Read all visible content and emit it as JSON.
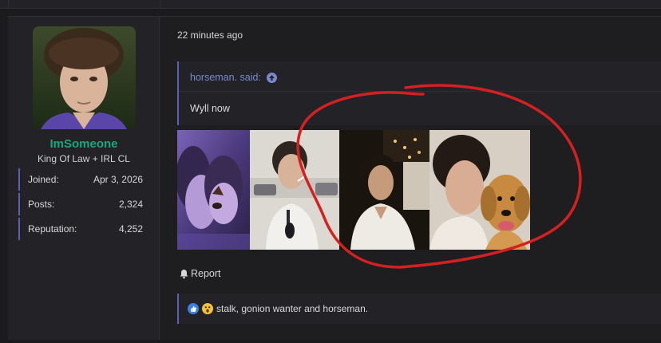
{
  "post": {
    "user": {
      "username": "ImSomeone",
      "title": "King Of Law + IRL CL",
      "stats": [
        {
          "label": "Joined:",
          "value": "Apr 3, 2026"
        },
        {
          "label": "Posts:",
          "value": "2,324"
        },
        {
          "label": "Reputation:",
          "value": "4,252"
        }
      ]
    },
    "timestamp": "22 minutes ago",
    "quote": {
      "author_said": "horseman. said:",
      "body": "Wyll now"
    },
    "images": [
      {
        "icon": "photo-filtered-selfie"
      },
      {
        "icon": "photo-man-white-shirt"
      },
      {
        "icon": "photo-man-night-town"
      },
      {
        "icon": "photo-man-with-dog"
      }
    ],
    "report_label": "Report",
    "reactions": {
      "text": "stalk, gonion wanter and horseman.",
      "icons": [
        "like-icon",
        "wow-icon"
      ]
    }
  },
  "colors": {
    "username": "#1ea67a",
    "accent": "#5a5fb8",
    "quote_author": "#7a88d0",
    "annotation": "#d42020"
  }
}
